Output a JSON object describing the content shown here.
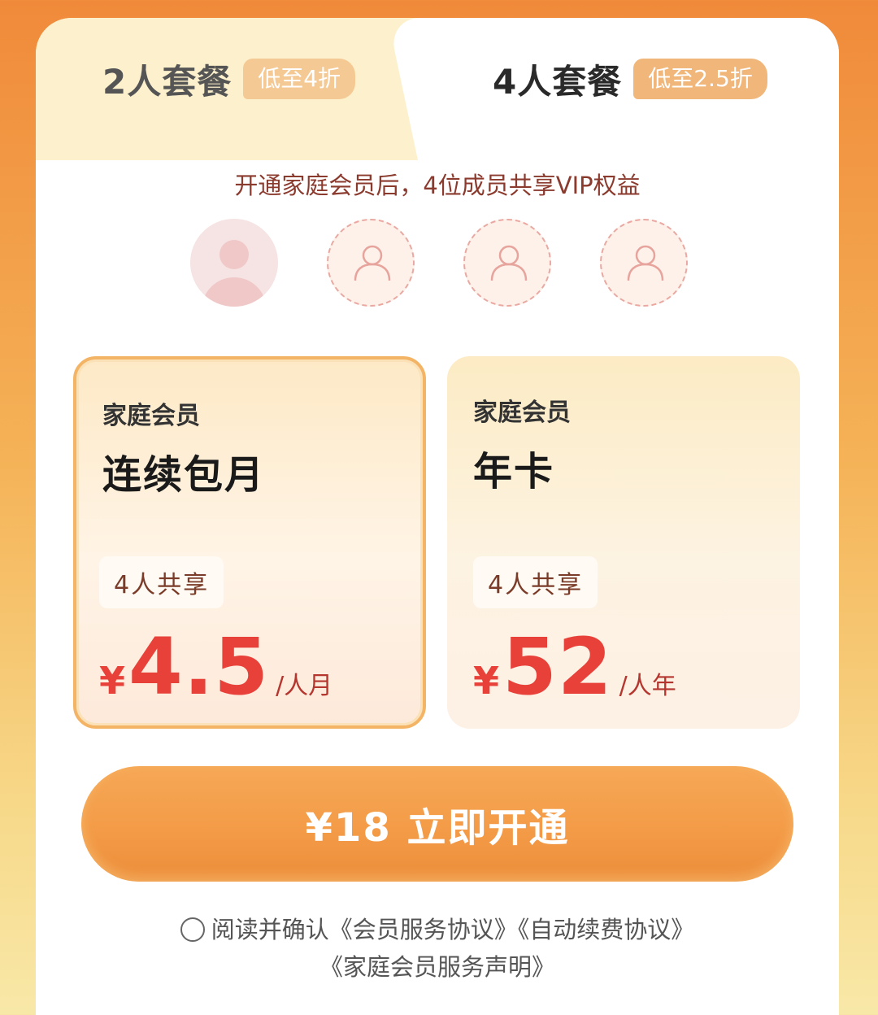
{
  "tabs": [
    {
      "label": "2人套餐",
      "badge": "低至4折",
      "active": false
    },
    {
      "label": "4人套餐",
      "badge": "低至2.5折",
      "active": true
    }
  ],
  "subtitle": "开通家庭会员后，4位成员共享VIP权益",
  "members": [
    {
      "state": "filled",
      "icon": "avatar-placeholder"
    },
    {
      "state": "empty",
      "icon": "person-outline-icon"
    },
    {
      "state": "empty",
      "icon": "person-outline-icon"
    },
    {
      "state": "empty",
      "icon": "person-outline-icon"
    }
  ],
  "plans": [
    {
      "category": "家庭会员",
      "name": "连续包月",
      "share": "4人共享",
      "currency": "¥",
      "price": "4.5",
      "unit": "/人月",
      "selected": true
    },
    {
      "category": "家庭会员",
      "name": "年卡",
      "share": "4人共享",
      "currency": "¥",
      "price": "52",
      "unit": "/人年",
      "selected": false
    }
  ],
  "cta": {
    "label": "¥18 立即开通"
  },
  "agreement": {
    "prefix": "阅读并确认",
    "link1": "《会员服务协议》",
    "link2": "《自动续费协议》",
    "link3": "《家庭会员服务声明》"
  },
  "colors": {
    "accent": "#f39a46",
    "price": "#e8413a",
    "badge": "#f0b67a"
  }
}
